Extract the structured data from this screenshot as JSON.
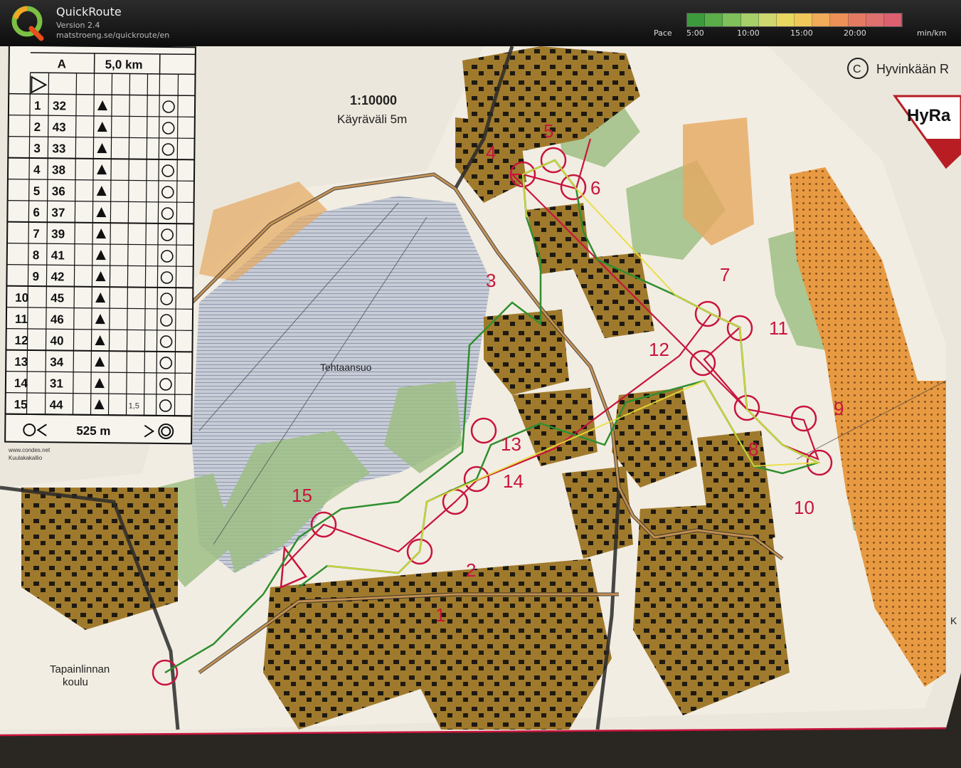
{
  "header": {
    "app_name": "QuickRoute",
    "version": "Version 2.4",
    "url": "matstroeng.se/quickroute/en",
    "pace_label": "Pace",
    "pace_ticks": [
      "5:00",
      "10:00",
      "15:00",
      "20:00"
    ],
    "pace_unit": "min/km",
    "pace_colors": [
      "#3c9b3c",
      "#5aad48",
      "#7fc05a",
      "#a8d06a",
      "#cfd86e",
      "#e8d860",
      "#f0c85a",
      "#f0ac58",
      "#ec9058",
      "#e57a62",
      "#e07070",
      "#dc6070"
    ]
  },
  "map": {
    "scale": "1:10000",
    "contour": "Käyräväli 5m",
    "copyright": "Hyvinkään R",
    "club_logo": "HyRa",
    "place_names": {
      "swamp": "Tehtaansuo",
      "school_line1": "Tapainlinnan",
      "school_line2": "koulu"
    },
    "edge_letter": "K",
    "small_credit_1": "www.condes.net",
    "small_credit_2": "Kuulakakallio",
    "control_numbers": [
      "1",
      "2",
      "3",
      "4",
      "5",
      "6",
      "7",
      "8",
      "9",
      "10",
      "11",
      "12",
      "13",
      "14",
      "15"
    ]
  },
  "legend": {
    "class": "A",
    "length": "5,0 km",
    "controls": [
      {
        "n": "1",
        "code": "32"
      },
      {
        "n": "2",
        "code": "43"
      },
      {
        "n": "3",
        "code": "33"
      },
      {
        "n": "4",
        "code": "38"
      },
      {
        "n": "5",
        "code": "36"
      },
      {
        "n": "6",
        "code": "37"
      },
      {
        "n": "7",
        "code": "39"
      },
      {
        "n": "8",
        "code": "41"
      },
      {
        "n": "9",
        "code": "42"
      },
      {
        "n": "10",
        "code": "45"
      },
      {
        "n": "11",
        "code": "46"
      },
      {
        "n": "12",
        "code": "40"
      },
      {
        "n": "13",
        "code": "34"
      },
      {
        "n": "14",
        "code": "31"
      },
      {
        "n": "15",
        "code": "44"
      }
    ],
    "note_15": "1,5",
    "finish_distance": "525 m"
  }
}
